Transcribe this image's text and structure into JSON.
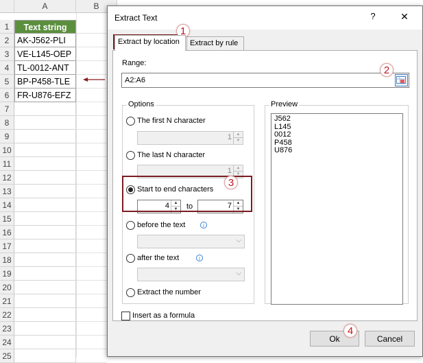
{
  "sheet": {
    "col_headers": [
      "A",
      "B"
    ],
    "row_numbers": [
      "1",
      "2",
      "3",
      "4",
      "5",
      "6",
      "7",
      "8",
      "9",
      "10",
      "11",
      "12",
      "13",
      "14",
      "15",
      "16",
      "17",
      "18",
      "19",
      "20",
      "21",
      "22",
      "23",
      "24",
      "25"
    ],
    "header_cell": "Text string",
    "cells": [
      "AK-J562-PLI",
      "VE-L145-OEP",
      "TL-0012-ANT",
      "BP-P458-TLE",
      "FR-U876-EFZ"
    ]
  },
  "dialog": {
    "title": "Extract Text",
    "help_label": "?",
    "close_label": "✕",
    "tabs": [
      {
        "label": "Extract by location",
        "active": true
      },
      {
        "label": "Extract by rule",
        "active": false
      }
    ],
    "range_label": "Range:",
    "range_value": "A2:A6",
    "options_title": "Options",
    "preview_title": "Preview",
    "options": {
      "first_n": {
        "label": "The first N character",
        "value": "1"
      },
      "last_n": {
        "label": "The last N character",
        "value": "1"
      },
      "start_end": {
        "label": "Start to end characters",
        "from": "4",
        "to_label": "to",
        "to": "7"
      },
      "before": {
        "label": "before the text",
        "info": "i"
      },
      "after": {
        "label": "after the text",
        "info": "i"
      },
      "number": {
        "label": "Extract the number"
      }
    },
    "preview_lines": [
      "J562",
      "L145",
      "0012",
      "P458",
      "U876"
    ],
    "insert_formula_label": "Insert as a formula",
    "ok_label": "Ok",
    "cancel_label": "Cancel"
  },
  "callouts": [
    "1",
    "2",
    "3",
    "4"
  ],
  "colors": {
    "header_green": "#5b8f3e",
    "callout_red": "#c0161e",
    "highlight": "#7a1c22",
    "arrow": "#8b1a1a"
  }
}
